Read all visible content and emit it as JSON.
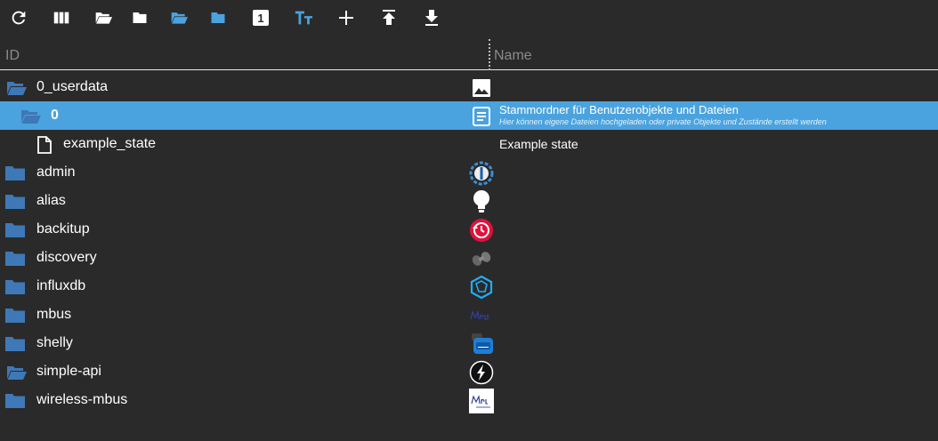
{
  "toolbar": {
    "buttons": [
      {
        "icon": "refresh-icon"
      },
      {
        "icon": "columns-icon"
      },
      {
        "icon": "folder-open-icon"
      },
      {
        "icon": "folder-icon"
      },
      {
        "icon": "folder-open-blue-icon"
      },
      {
        "icon": "folder-blue-icon"
      },
      {
        "icon": "number-one-badge-icon",
        "text": "1"
      },
      {
        "icon": "text-size-icon"
      },
      {
        "icon": "add-icon"
      },
      {
        "icon": "upload-icon"
      },
      {
        "icon": "download-icon"
      }
    ]
  },
  "header": {
    "id_label": "ID",
    "name_label": "Name"
  },
  "colors": {
    "background": "#2a2a2a",
    "selected_row": "#4aa3df",
    "folder": "#3e78b7",
    "header_text": "#8a8a8a"
  },
  "rows": [
    {
      "id": "0_userdata",
      "icon": "folder-open-icon",
      "obj_icon": "image-icon",
      "name": "",
      "desc": ""
    },
    {
      "id": "0",
      "icon": "folder-open-icon",
      "obj_icon": "document-icon",
      "name": "Stammordner für Benutzerobjekte und Dateien",
      "desc": "Hier können eigene Dateien hochgeladen oder private Objekte und Zustände erstellt werden",
      "selected": true
    },
    {
      "id": "example_state",
      "icon": "file-icon",
      "obj_icon": "",
      "name": "Example state",
      "desc": ""
    },
    {
      "id": "admin",
      "icon": "folder-icon",
      "obj_icon": "admin-logo-icon",
      "name": "",
      "desc": ""
    },
    {
      "id": "alias",
      "icon": "folder-icon",
      "obj_icon": "lightbulb-icon",
      "name": "",
      "desc": ""
    },
    {
      "id": "backitup",
      "icon": "folder-icon",
      "obj_icon": "backup-clock-icon",
      "name": "",
      "desc": ""
    },
    {
      "id": "discovery",
      "icon": "folder-icon",
      "obj_icon": "binoculars-icon",
      "name": "",
      "desc": ""
    },
    {
      "id": "influxdb",
      "icon": "folder-icon",
      "obj_icon": "influxdb-logo-icon",
      "name": "",
      "desc": ""
    },
    {
      "id": "mbus",
      "icon": "folder-icon",
      "obj_icon": "mbus-logo-icon",
      "name": "",
      "desc": ""
    },
    {
      "id": "shelly",
      "icon": "folder-icon",
      "obj_icon": "shelly-logo-icon",
      "name": "",
      "desc": ""
    },
    {
      "id": "simple-api",
      "icon": "folder-open-icon",
      "obj_icon": "simple-api-logo-icon",
      "name": "",
      "desc": ""
    },
    {
      "id": "wireless-mbus",
      "icon": "folder-icon",
      "obj_icon": "wireless-mbus-logo-icon",
      "name": "",
      "desc": ""
    }
  ]
}
